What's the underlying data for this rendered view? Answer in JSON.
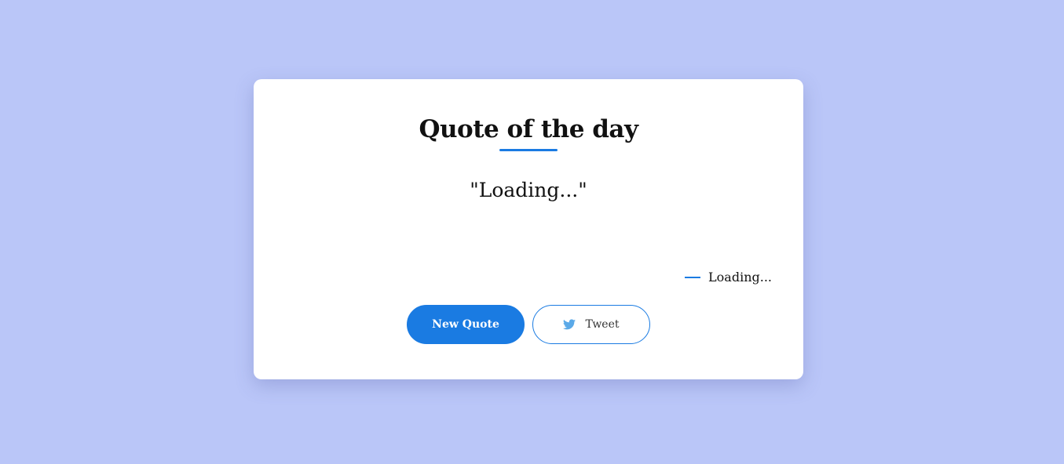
{
  "card": {
    "title": "Quote of the day",
    "quote_text": "\"Loading...\"",
    "author": "Loading...",
    "buttons": {
      "new_quote_label": "New Quote",
      "tweet_label": "Tweet"
    }
  },
  "icons": {
    "tweet": "twitter-bird-icon"
  },
  "colors": {
    "background": "#bac6f8",
    "accent": "#1a7be2",
    "card": "#ffffff",
    "twitter": "#5aa9e8"
  }
}
